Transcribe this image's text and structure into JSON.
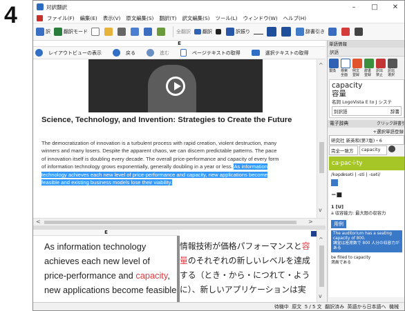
{
  "step_number": "4",
  "app": {
    "title": "対訳翻訳",
    "window_buttons": [
      "–",
      "□",
      "✕"
    ]
  },
  "menu": [
    "ファイル(F)",
    "編集(E)",
    "表示(V)",
    "原文編集(S)",
    "翻訳(T)",
    "訳文編集(S)",
    "ツール(L)",
    "ウィンドウ(W)",
    "ヘルプ(H)"
  ],
  "toolbar": [
    "訳",
    "翻訳モード",
    "全翻訳",
    "翻訳",
    "訳振り",
    "辞書引き"
  ],
  "left_panel": {
    "header": "E",
    "sub_toolbar": {
      "layout": "レイアウトビューの表示",
      "back": "戻る",
      "forward": "進む",
      "get_page_text": "ページテキストの取得",
      "get_selected_text": "選択テキストの取得"
    },
    "article": {
      "title": "Science, Technology, and Invention: Strategies to Create the Future",
      "body_lines": [
        "The democratization of innovation is a turbulent process with rapid creation, violent destruction, many",
        "winners and many losers. Despite the apparent chaos, we can discern predictable patterns. The pace",
        "of innovation itself is doubling every decade. The overall price-performance and capacity of every form"
      ],
      "line4_plain": "of information technology grows exponentially, generally doubling in a year or less. ",
      "line4_selected": "As information",
      "selected_lines": [
        "technology achieves each new level of price-performance and capacity, new applications become",
        "feasible and existing business models lose their viability."
      ]
    },
    "source_pane_header": "E",
    "source_lines": [
      "As information technology",
      "achieves each new level of"
    ],
    "source_line3_before": "price-performance and ",
    "source_line3_red": "capacity",
    "source_line3_after": ",",
    "source_line4": "new applications become feasible"
  },
  "target_pane": {
    "line1_before": "情報技術が価格パフォーマンスと",
    "line1_red": "容",
    "line2_red": "量",
    "line2_after": "のそれぞれの新しいレベルを達成",
    "line3": "する（とき・から・につれて・よう",
    "line4": "に）、新しいアプリケーションは実"
  },
  "right_panel": {
    "header": "単語情報",
    "tab": "訳語",
    "icon_labels": [
      "置換",
      "検索\n全面",
      "例文\n登録",
      "辞書\n登録",
      "訳出\n禁止",
      "訳出\n選択"
    ],
    "word": "capacity",
    "translation": "容量",
    "pos": "名詞  LogoVista E to J システ",
    "alt_field": "別訳語",
    "alt_field2": "辞書",
    "e_dict_header": "電子辞典",
    "click_search": "クリック辞書引",
    "add_selection": "+選択単語登録",
    "dict_select": "研究社 新英和(第7版)・6",
    "match_select": "完全一致方",
    "match_word": "capacity",
    "headword": "ca·pac·i·ty",
    "pronunciation": "/kəpǽsəti | ‐sti | ‐səti/",
    "num": "1 [U]",
    "def_label": "a 収容能力: 最大限の収容力",
    "example_tag": "用例",
    "example_en": "The auditorium has a seating capacity of 800.",
    "example_ja": "講堂は座席数で 800 人分の収容力がある",
    "example2_en": "be filled to capacity",
    "example2_ja": "満員である"
  },
  "status": {
    "mode": "待機中",
    "text_label": "原文",
    "count": "5 / 5 文",
    "state": "翻訳済み",
    "direction": "英語から日本語へ",
    "extra": "機械"
  }
}
